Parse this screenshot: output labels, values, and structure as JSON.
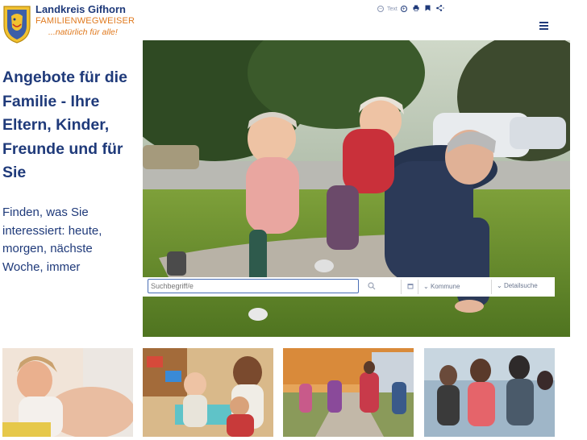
{
  "header": {
    "org_name": "Landkreis Gifhorn",
    "site_name": "FAMILIENWEGWEISER",
    "tagline": "...natürlich für alle!"
  },
  "toolbar": {
    "text_size_label": "Text",
    "icons": [
      "text-decrease-icon",
      "text-increase-icon",
      "print-icon",
      "bookmark-icon",
      "share-icon"
    ]
  },
  "hero": {
    "headline": "Angebote für die Familie - Ihre Eltern, Kinder, Freunde und für Sie",
    "subtext": "Finden, was Sie interessiert: heute, morgen, nächste Woche, immer"
  },
  "search": {
    "placeholder": "Suchbegriff/e",
    "kommune_label": "Kommune",
    "detail_label": "Detailsuche"
  },
  "colors": {
    "brand_blue": "#1f3a7a",
    "accent_orange": "#e07a1f",
    "input_border": "#4a6fb5"
  },
  "tiles": [
    "tile-pregnancy",
    "tile-kindergarten",
    "tile-school",
    "tile-fitness"
  ]
}
